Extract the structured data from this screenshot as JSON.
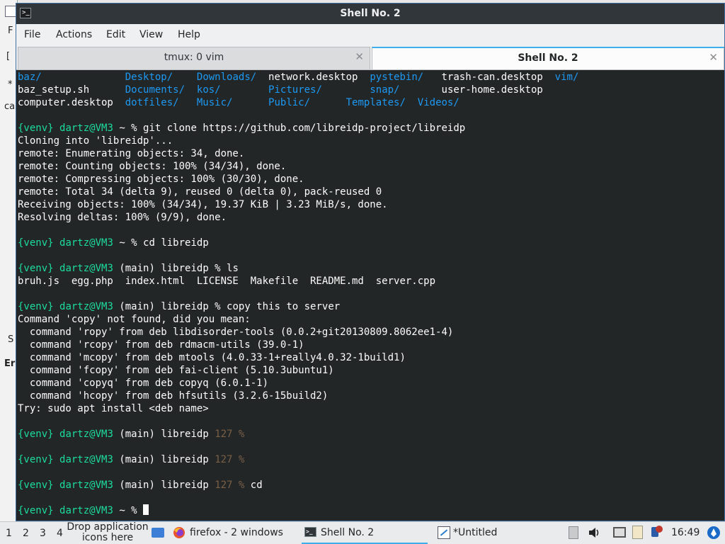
{
  "background_window": {
    "chars": [
      "F",
      "[",
      "*",
      "ca",
      "S",
      "Er"
    ]
  },
  "window": {
    "title": "Shell No. 2",
    "menu": [
      "File",
      "Actions",
      "Edit",
      "View",
      "Help"
    ],
    "tabs": [
      {
        "label": "tmux: 0 vim",
        "active": false
      },
      {
        "label": "Shell No. 2",
        "active": true
      }
    ]
  },
  "terminal": {
    "ls_rows": [
      [
        "baz/",
        "Desktop/",
        "Downloads/",
        "network.desktop",
        "pystebin/",
        "trash-can.desktop",
        "vim/"
      ],
      [
        "baz_setup.sh",
        "Documents/",
        "kos/",
        "Pictures/",
        "snap/",
        "user-home.desktop",
        ""
      ],
      [
        "computer.desktop",
        "dotfiles/",
        "Music/",
        "Public/",
        "Templates/",
        "Videos/",
        ""
      ]
    ],
    "prompt_venv": "{venv}",
    "prompt_user": "dartz@VM3",
    "cmd_clone": "~ % git clone https://github.com/libreidp-project/libreidp",
    "clone_output": [
      "Cloning into 'libreidp'...",
      "remote: Enumerating objects: 34, done.",
      "remote: Counting objects: 100% (34/34), done.",
      "remote: Compressing objects: 100% (30/30), done.",
      "remote: Total 34 (delta 9), reused 0 (delta 0), pack-reused 0",
      "Receiving objects: 100% (34/34), 19.37 KiB | 3.23 MiB/s, done.",
      "Resolving deltas: 100% (9/9), done."
    ],
    "cmd_cd": "~ % cd libreidp",
    "cmd_ls": "(main) libreidp % ls",
    "ls_files": "bruh.js  egg.php  index.html  LICENSE  Makefile  README.md  server.cpp",
    "cmd_copy": "(main) libreidp % copy this to server",
    "copy_output": [
      "Command 'copy' not found, did you mean:",
      "  command 'ropy' from deb libdisorder-tools (0.0.2+git20130809.8062ee1-4)",
      "  command 'rcopy' from deb rdmacm-utils (39.0-1)",
      "  command 'mcopy' from deb mtools (4.0.33-1+really4.0.32-1build1)",
      "  command 'fcopy' from deb fai-client (5.10.3ubuntu1)",
      "  command 'copyq' from deb copyq (6.0.1-1)",
      "  command 'hcopy' from deb hfsutils (3.2.6-15build2)",
      "Try: sudo apt install <deb name>"
    ],
    "prompt_main_dir": "(main) libreidp",
    "exit_code_prompt": "127 %",
    "cmd_last": "cd",
    "final_prompt": "~ %"
  },
  "taskbar": {
    "workspaces": [
      "1",
      "2",
      "3",
      "4"
    ],
    "drop_text": "Drop application icons here",
    "items": [
      {
        "label": "firefox - 2 windows",
        "icon": "firefox-icon"
      },
      {
        "label": "Shell No. 2",
        "icon": "terminal-icon"
      },
      {
        "label": "*Untitled",
        "icon": "text-editor-icon"
      }
    ],
    "clock": "16:49"
  }
}
